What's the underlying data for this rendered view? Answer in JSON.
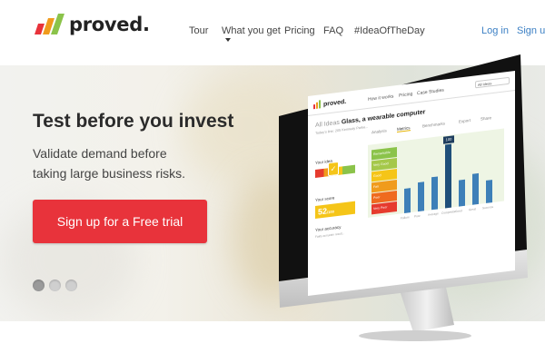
{
  "brand": {
    "name": "proved.",
    "logo_icon": "bar-chart-logo-icon",
    "logo_colors": [
      "#e8333b",
      "#f09b1c",
      "#8bc34a"
    ]
  },
  "nav": {
    "items": [
      {
        "label": "Tour"
      },
      {
        "label": "What you get"
      },
      {
        "label": "Pricing"
      },
      {
        "label": "FAQ"
      },
      {
        "label": "#IdeaOfTheDay"
      }
    ],
    "login_label": "Log in",
    "signup_label": "Sign up"
  },
  "hero": {
    "title": "Test before you invest",
    "subtitle_line1": "Validate demand before",
    "subtitle_line2": "taking large business risks.",
    "cta_label": "Sign up for a Free trial",
    "cta_color": "#e8333b",
    "slider": {
      "count": 3,
      "active": 1
    }
  },
  "screen": {
    "logo_text": "proved.",
    "nav": [
      "How it works",
      "Pricing",
      "Case Studies"
    ],
    "select_value": "All Ideas",
    "breadcrumb": "All Ideas",
    "title": "Glass, a wearable computer",
    "date_text": "Today's line: 205 Kennedy Parke...",
    "tabs": [
      "Analysis",
      "Metrics",
      "Benchmarks",
      "Export",
      "Share"
    ],
    "active_tab": "Metrics",
    "idea_label": "Your idea",
    "score_label": "Your score",
    "score_value": "52",
    "score_unit": "/100",
    "accuracy_label": "Your accuracy",
    "accuracy_text": "Fairly accurate result...",
    "flag_value": "100",
    "legend": [
      {
        "label": "Remarkable",
        "color": "#8bc34a"
      },
      {
        "label": "Very Good",
        "color": "#a5c84a"
      },
      {
        "label": "Good",
        "color": "#f5c518"
      },
      {
        "label": "Fair",
        "color": "#f09b1c"
      },
      {
        "label": "Poor",
        "color": "#ef6a1e"
      },
      {
        "label": "Very Poor",
        "color": "#e63b2e"
      }
    ],
    "bars": [
      0.38,
      0.45,
      0.52,
      1.0,
      0.42,
      0.48,
      0.36
    ],
    "bar_labels": [
      "Failure",
      "Poor",
      "Average",
      "Competitor",
      "Good",
      "Great",
      "Success"
    ]
  }
}
